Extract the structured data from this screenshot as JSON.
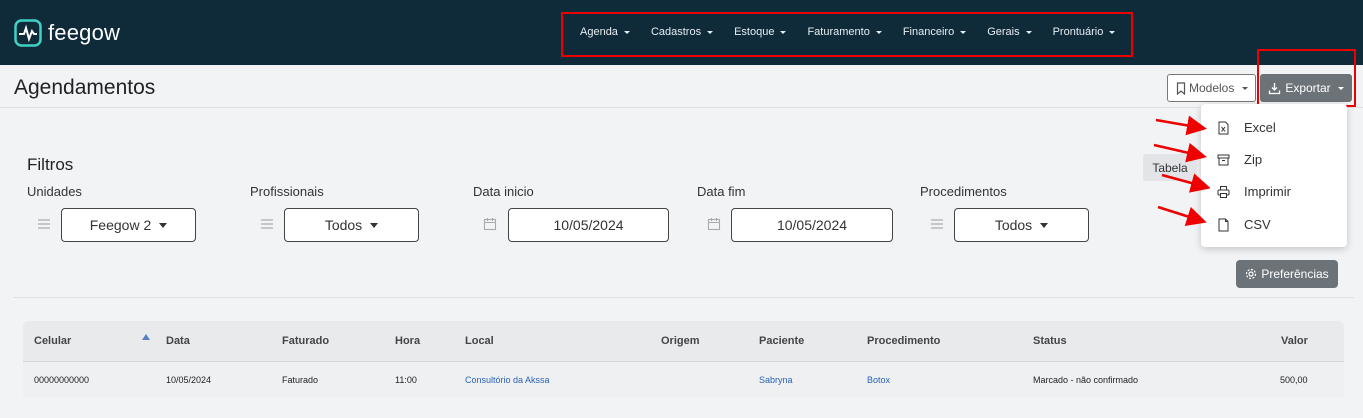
{
  "app": {
    "name": "feegow"
  },
  "nav": {
    "items": [
      {
        "label": "Agenda"
      },
      {
        "label": "Cadastros"
      },
      {
        "label": "Estoque"
      },
      {
        "label": "Faturamento"
      },
      {
        "label": "Financeiro"
      },
      {
        "label": "Gerais"
      },
      {
        "label": "Prontuário"
      }
    ]
  },
  "page": {
    "title": "Agendamentos"
  },
  "toolbar": {
    "modelos_label": "Modelos",
    "exportar_label": "Exportar",
    "tabela_label": "Tabela"
  },
  "export_menu": {
    "items": [
      {
        "label": "Excel",
        "icon": "excel-file-icon"
      },
      {
        "label": "Zip",
        "icon": "archive-icon"
      },
      {
        "label": "Imprimir",
        "icon": "printer-icon"
      },
      {
        "label": "CSV",
        "icon": "file-icon"
      }
    ]
  },
  "filters": {
    "title": "Filtros",
    "unidades": {
      "label": "Unidades",
      "value": "Feegow 2"
    },
    "profissionais": {
      "label": "Profissionais",
      "value": "Todos"
    },
    "data_inicio": {
      "label": "Data inicio",
      "value": "10/05/2024"
    },
    "data_fim": {
      "label": "Data fim",
      "value": "10/05/2024"
    },
    "procedimentos": {
      "label": "Procedimentos",
      "value": "Todos"
    },
    "preferencias_label": "Preferências"
  },
  "table": {
    "columns": [
      "Celular",
      "Data",
      "Faturado",
      "Hora",
      "Local",
      "Origem",
      "Paciente",
      "Procedimento",
      "Status",
      "Valor"
    ],
    "rows": [
      {
        "celular": "00000000000",
        "data": "10/05/2024",
        "faturado": "Faturado",
        "hora": "11:00",
        "local": "Consultório da Akssa",
        "origem": "",
        "paciente": "Sabryna",
        "procedimento": "Botox",
        "status": "Marcado - não confirmado",
        "valor": "500,00"
      }
    ]
  },
  "colors": {
    "topbar": "#0f2b3a",
    "highlight": "#ee0000",
    "button_gray": "#6c7378",
    "link": "#2a62b8"
  }
}
